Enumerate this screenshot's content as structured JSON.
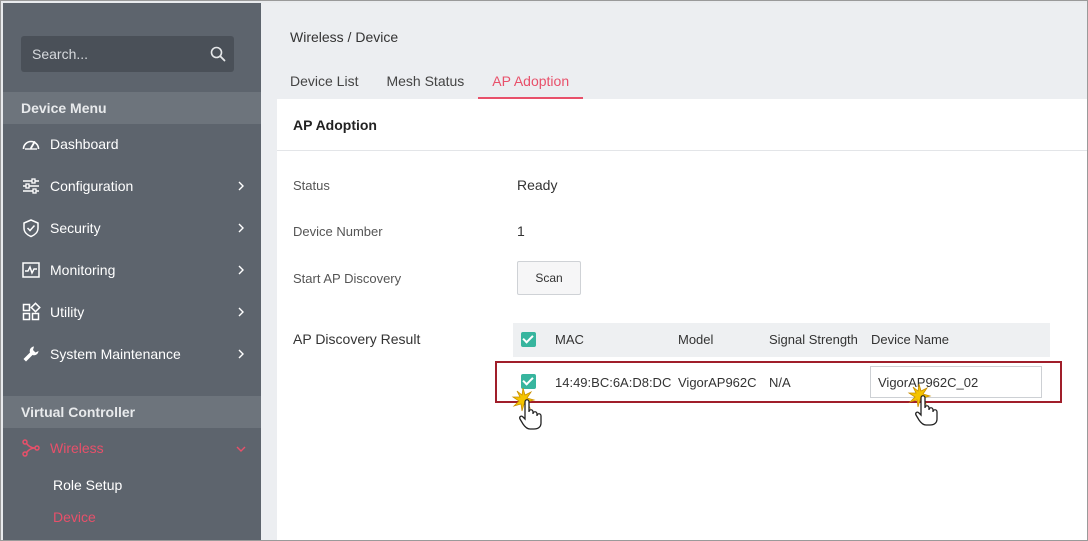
{
  "sidebar": {
    "search_placeholder": "Search...",
    "device_menu_title": "Device Menu",
    "items": [
      {
        "label": "Dashboard"
      },
      {
        "label": "Configuration"
      },
      {
        "label": "Security"
      },
      {
        "label": "Monitoring"
      },
      {
        "label": "Utility"
      },
      {
        "label": "System Maintenance"
      }
    ],
    "virtual_controller_title": "Virtual Controller",
    "wireless_label": "Wireless",
    "sub_items": [
      {
        "label": "Role Setup"
      },
      {
        "label": "Device"
      }
    ]
  },
  "main": {
    "breadcrumb": "Wireless / Device",
    "tabs": [
      {
        "label": "Device List"
      },
      {
        "label": "Mesh Status"
      },
      {
        "label": "AP Adoption"
      }
    ],
    "card_title": "AP Adoption",
    "fields": {
      "status_label": "Status",
      "status_value": "Ready",
      "device_number_label": "Device Number",
      "device_number_value": "1",
      "start_discovery_label": "Start AP Discovery",
      "scan_label": "Scan"
    },
    "result_label": "AP Discovery Result",
    "table": {
      "headers": [
        "MAC",
        "Model",
        "Signal Strength",
        "Device Name"
      ],
      "rows": [
        {
          "mac": "14:49:BC:6A:D8:DC",
          "model": "VigorAP962C",
          "signal": "N/A",
          "device_name": "VigorAP962C_02"
        }
      ]
    }
  },
  "colors": {
    "accent": "#e8506a",
    "sidebar_bg": "#5d646d",
    "checkbox": "#37b59e",
    "highlight_border": "#a01e2a"
  }
}
